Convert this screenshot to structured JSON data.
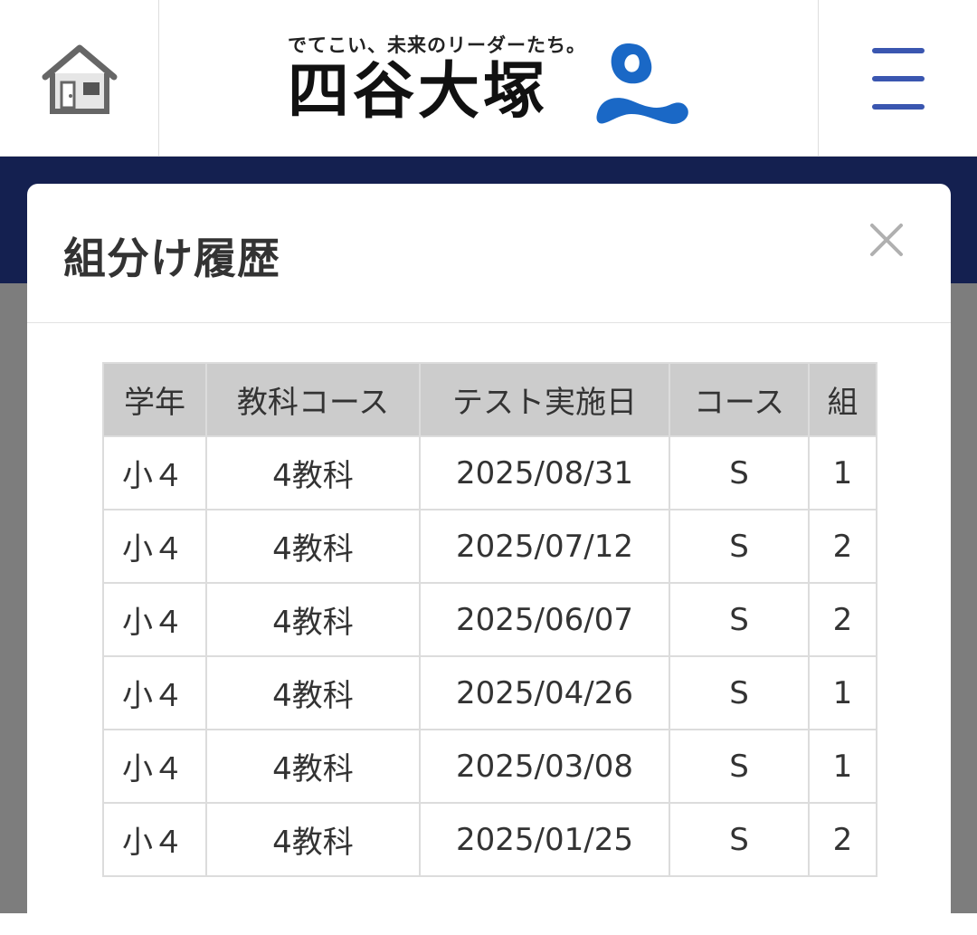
{
  "header": {
    "logo_tagline": "でてこい、未来のリーダーたち。",
    "logo_name": "四谷大塚",
    "home_icon": "house-icon",
    "menu_icon": "hamburger-menu-icon",
    "accent_color": "#1a68c6"
  },
  "modal": {
    "title": "組分け履歴",
    "close_icon": "close-icon",
    "table": {
      "headers": [
        "学年",
        "教科コース",
        "テスト実施日",
        "コース",
        "組"
      ],
      "rows": [
        [
          "小４",
          "4教科",
          "2025/08/31",
          "S",
          "1"
        ],
        [
          "小４",
          "4教科",
          "2025/07/12",
          "S",
          "2"
        ],
        [
          "小４",
          "4教科",
          "2025/06/07",
          "S",
          "2"
        ],
        [
          "小４",
          "4教科",
          "2025/04/26",
          "S",
          "1"
        ],
        [
          "小４",
          "4教科",
          "2025/03/08",
          "S",
          "1"
        ],
        [
          "小４",
          "4教科",
          "2025/01/25",
          "S",
          "2"
        ]
      ]
    }
  }
}
